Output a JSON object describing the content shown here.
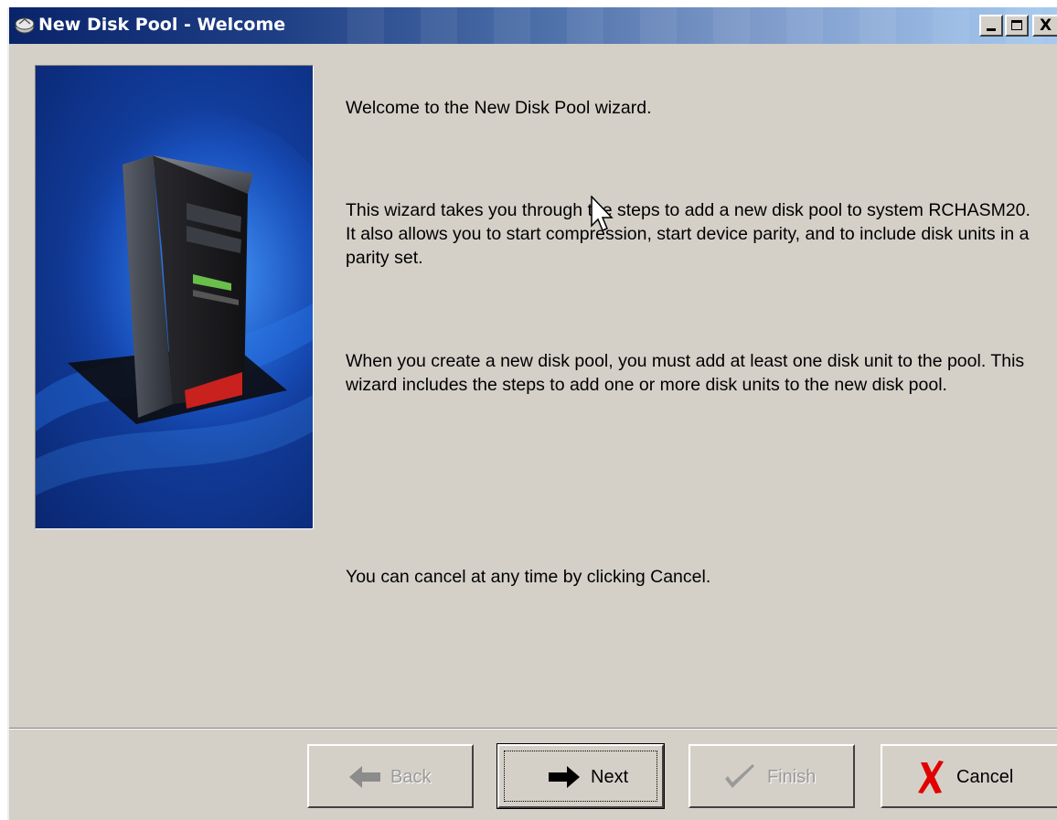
{
  "window": {
    "title": "New Disk Pool - Welcome",
    "title_icon": "disk-pool-icon",
    "controls": {
      "minimize": "minimize-icon",
      "maximize": "maximize-icon",
      "close_glyph": "X"
    }
  },
  "hero_image": {
    "description_icon": "server-tower-image"
  },
  "content": {
    "p1": "Welcome to the New Disk Pool wizard.",
    "p2": "This wizard takes you through the steps to add a new disk pool to system RCHASM20.  It also allows you to start compression, start device parity, and to include disk units in a parity set.",
    "p3": "When you create a new disk pool, you must add at least one disk unit to the pool. This wizard includes the steps to add one or more disk units to the new disk pool.",
    "p4": "You can cancel at any time by clicking Cancel."
  },
  "buttons": {
    "back": {
      "label": "Back",
      "icon": "back-arrow-icon",
      "enabled": false
    },
    "next": {
      "label": "Next",
      "icon": "next-arrow-icon",
      "enabled": true
    },
    "finish": {
      "label": "Finish",
      "icon": "checkmark-icon",
      "enabled": false
    },
    "cancel": {
      "label": "Cancel",
      "icon": "red-x-icon",
      "enabled": true
    }
  },
  "colors": {
    "window_bg": "#d4d0c8",
    "title_active": "#0a246a",
    "hero_blue": "#123e9e",
    "cancel_red": "#e00000"
  }
}
